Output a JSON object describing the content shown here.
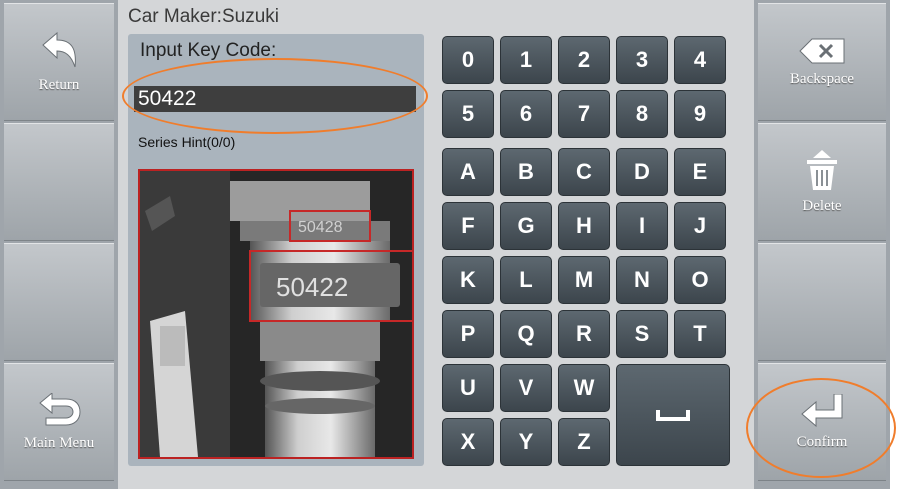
{
  "header": {
    "car_maker": "Car Maker:Suzuki"
  },
  "left_nav": {
    "return_label": "Return",
    "main_menu_label": "Main Menu"
  },
  "right_nav": {
    "backspace_label": "Backspace",
    "delete_label": "Delete",
    "confirm_label": "Confirm"
  },
  "input": {
    "prompt": "Input Key Code:",
    "value": "50422"
  },
  "series_hint": "Series Hint(0/0)",
  "photo": {
    "upper_code": "50428",
    "lower_code": "50422"
  },
  "keypad": {
    "digits_row1": [
      "0",
      "1",
      "2",
      "3",
      "4"
    ],
    "digits_row2": [
      "5",
      "6",
      "7",
      "8",
      "9"
    ],
    "letters": [
      [
        "A",
        "B",
        "C",
        "D",
        "E"
      ],
      [
        "F",
        "G",
        "H",
        "I",
        "J"
      ],
      [
        "K",
        "L",
        "M",
        "N",
        "O"
      ],
      [
        "P",
        "Q",
        "R",
        "S",
        "T"
      ],
      [
        "U",
        "V",
        "W"
      ],
      [
        "X",
        "Y",
        "Z"
      ]
    ],
    "space_label": "␣"
  },
  "colors": {
    "key": "#4a555d",
    "annotation": "#f07d2c",
    "photo_box": "#b22222"
  }
}
